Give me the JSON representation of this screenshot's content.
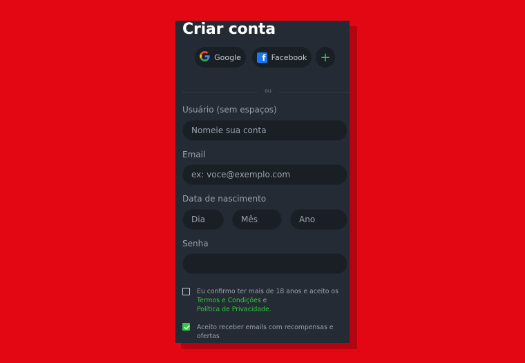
{
  "form": {
    "title": "Criar conta",
    "social": {
      "google_label": "Google",
      "facebook_label": "Facebook",
      "more_label": "+"
    },
    "divider_text": "ou",
    "username": {
      "label": "Usuário (sem espaços)",
      "placeholder": "Nomeie sua conta"
    },
    "email": {
      "label": "Email",
      "placeholder": "ex: voce@exemplo.com"
    },
    "birthdate": {
      "label": "Data de nascimento",
      "day_placeholder": "Dia",
      "month_placeholder": "Mês",
      "year_placeholder": "Ano"
    },
    "password": {
      "label": "Senha",
      "placeholder": ""
    },
    "age_terms": {
      "checked": false,
      "text_before": "Eu confirmo ter mais de 18 anos e aceito os",
      "terms_link": "Termos e Condições",
      "conjunction": "e",
      "privacy_link": "Política de Privacidade."
    },
    "marketing": {
      "checked": true,
      "text": "Aceito receber emails com recompensas e ofertas"
    }
  },
  "colors": {
    "background": "#e30613",
    "panel": "#252b34",
    "input": "#1a1f26",
    "accent": "#2ecc40",
    "facebook": "#1877f2"
  },
  "icons": {
    "google": "google-icon",
    "facebook": "facebook-icon",
    "plus": "plus-icon",
    "check": "check-icon"
  }
}
